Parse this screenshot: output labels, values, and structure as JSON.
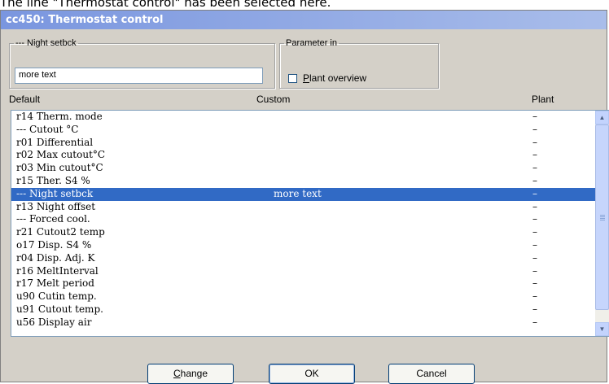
{
  "caption": "The line \"Thermostat control\" has been selected here.",
  "window": {
    "title": "cc450: Thermostat control"
  },
  "night_group": {
    "legend": "--- Night setbck",
    "text_value": "more text"
  },
  "param_group": {
    "legend": "Parameter in",
    "checkbox_label": "Plant overview",
    "checked": false
  },
  "columns": {
    "default": "Default",
    "custom": "Custom",
    "plant": "Plant"
  },
  "rows": [
    {
      "default": "r14 Therm. mode",
      "custom": "",
      "plant": "–"
    },
    {
      "default": "--- Cutout °C",
      "custom": "",
      "plant": "–"
    },
    {
      "default": "r01 Differential",
      "custom": "",
      "plant": "–"
    },
    {
      "default": "r02 Max cutout°C",
      "custom": "",
      "plant": "–"
    },
    {
      "default": "r03 Min cutout°C",
      "custom": "",
      "plant": "–"
    },
    {
      "default": "r15 Ther. S4 %",
      "custom": "",
      "plant": "–"
    },
    {
      "default": "--- Night setbck",
      "custom": "more text",
      "plant": "–"
    },
    {
      "default": "r13 Night offset",
      "custom": "",
      "plant": "–"
    },
    {
      "default": "--- Forced cool.",
      "custom": "",
      "plant": "–"
    },
    {
      "default": "r21 Cutout2 temp",
      "custom": "",
      "plant": "–"
    },
    {
      "default": "o17 Disp. S4 %",
      "custom": "",
      "plant": "–"
    },
    {
      "default": "r04 Disp. Adj. K",
      "custom": "",
      "plant": "–"
    },
    {
      "default": "r16 MeltInterval",
      "custom": "",
      "plant": "–"
    },
    {
      "default": "r17 Melt period",
      "custom": "",
      "plant": "–"
    },
    {
      "default": "u90 Cutin temp.",
      "custom": "",
      "plant": "–"
    },
    {
      "default": "u91 Cutout temp.",
      "custom": "",
      "plant": "–"
    },
    {
      "default": "u56 Display air",
      "custom": "",
      "plant": "–"
    }
  ],
  "selected_index": 6,
  "icons": {
    "scroll_up": "scroll-up-arrow-icon",
    "scroll_down": "scroll-down-arrow-icon"
  },
  "buttons": {
    "change": "Change",
    "ok": "OK",
    "cancel": "Cancel"
  },
  "colors": {
    "selection": "#316ac5",
    "titlebar": "#7a96df",
    "dialog_bg": "#d4d0c8"
  }
}
